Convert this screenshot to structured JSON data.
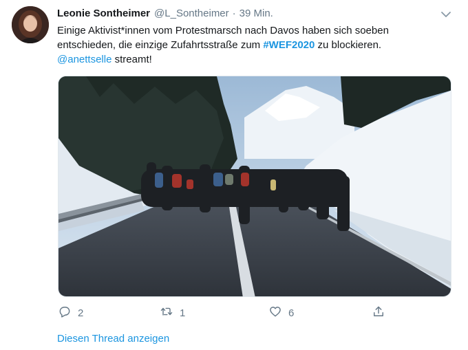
{
  "tweet": {
    "author_name": "Leonie Sontheimer",
    "author_handle": "@L_Sontheimer",
    "separator": "·",
    "timestamp": "39 Min.",
    "text_part1": "Einige Aktivist*innen vom Protestmarsch nach Davos haben sich soeben entschieden, die einzige Zufahrtsstraße zum ",
    "hashtag": "#WEF2020",
    "text_part2": " zu blockieren.",
    "mention": "@anettselle",
    "text_part3": " streamt!",
    "media": {
      "description_icon": "photo-road-blockade",
      "sky_color": "#cfe0ee",
      "snow_color": "#eef3f8",
      "road_color": "#3b4048"
    },
    "actions": {
      "reply_icon": "reply-icon",
      "reply_count": "2",
      "retweet_icon": "retweet-icon",
      "retweet_count": "1",
      "like_icon": "heart-icon",
      "like_count": "6",
      "share_icon": "share-icon"
    },
    "show_thread_label": "Diesen Thread anzeigen"
  },
  "colors": {
    "link": "#1b95e0",
    "muted": "#657786",
    "text": "#14171a"
  }
}
